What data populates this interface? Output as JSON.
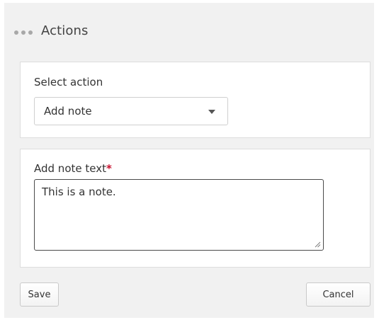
{
  "header": {
    "title": "Actions",
    "icon": "ellipsis-icon"
  },
  "action_section": {
    "label": "Select action",
    "select": {
      "value": "Add note",
      "icon": "caret-down-icon"
    }
  },
  "note_section": {
    "label": "Add note text",
    "required_marker": "*",
    "textarea_value": "This is a note."
  },
  "footer": {
    "save_label": "Save",
    "cancel_label": "Cancel"
  },
  "colors": {
    "panel_background": "#f1f1f1",
    "required_marker": "#c8102e"
  }
}
